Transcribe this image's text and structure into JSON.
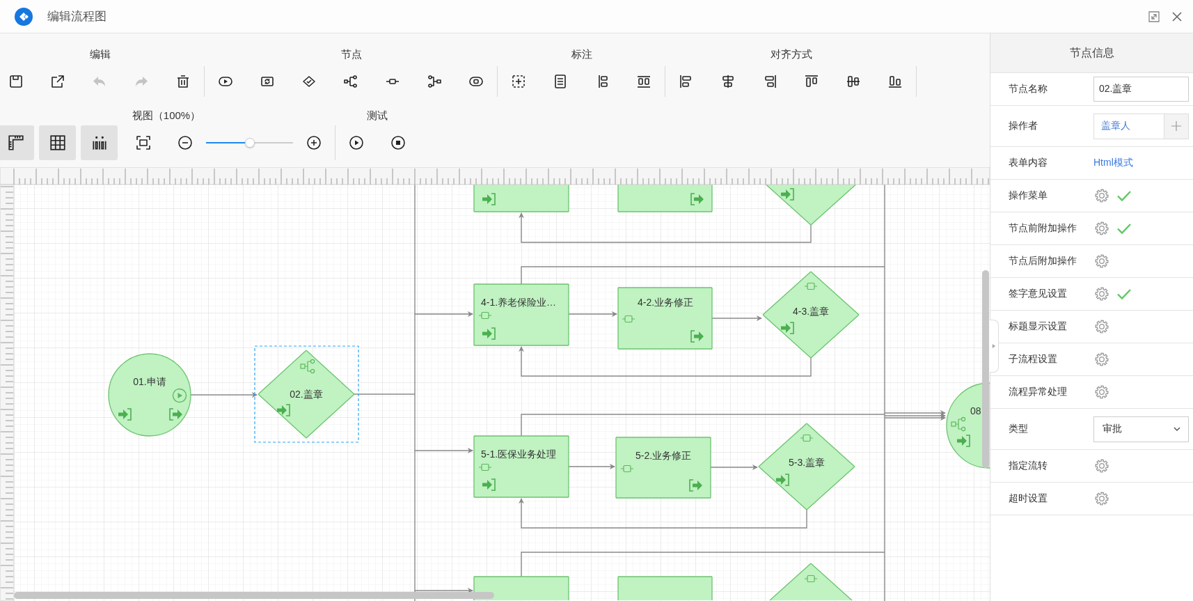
{
  "window": {
    "title": "编辑流程图"
  },
  "toolbar": {
    "rows": [
      {
        "groups": [
          {
            "label": "编辑",
            "tools": [
              {
                "kind": "button",
                "disabled": false
              },
              {
                "kind": "button",
                "disabled": false
              },
              {
                "kind": "button",
                "disabled": true
              },
              {
                "kind": "button",
                "disabled": true
              },
              {
                "kind": "button",
                "disabled": false
              }
            ]
          },
          {
            "label": "节点",
            "tools": [
              {
                "kind": "button",
                "disabled": false
              },
              {
                "kind": "button",
                "disabled": false
              },
              {
                "kind": "button",
                "disabled": false
              },
              {
                "kind": "button",
                "disabled": false
              },
              {
                "kind": "button",
                "disabled": false
              },
              {
                "kind": "button",
                "disabled": false
              },
              {
                "kind": "button",
                "disabled": false
              }
            ]
          },
          {
            "label": "标注",
            "tools": [
              {
                "kind": "button",
                "disabled": false
              },
              {
                "kind": "button",
                "disabled": false
              },
              {
                "kind": "button",
                "disabled": false
              },
              {
                "kind": "button",
                "disabled": false
              }
            ]
          },
          {
            "label": "对齐方式",
            "tools": [
              {
                "kind": "button",
                "disabled": false
              },
              {
                "kind": "button",
                "disabled": false
              },
              {
                "kind": "button",
                "disabled": false
              },
              {
                "kind": "button",
                "disabled": false
              },
              {
                "kind": "button",
                "disabled": false
              },
              {
                "kind": "button",
                "disabled": false
              }
            ]
          }
        ]
      },
      {
        "groups": [
          {
            "label": "视图（100%）",
            "tools": [
              {
                "kind": "toggle",
                "on": true
              },
              {
                "kind": "toggle",
                "on": true
              },
              {
                "kind": "toggle",
                "on": true
              },
              {
                "kind": "button",
                "disabled": false
              },
              {
                "kind": "button",
                "disabled": false
              },
              {
                "kind": "slider",
                "level": 0.5
              },
              {
                "kind": "button",
                "disabled": false
              }
            ]
          },
          {
            "label": "测试",
            "tools": [
              {
                "kind": "button",
                "disabled": false
              },
              {
                "kind": "button",
                "disabled": false
              }
            ]
          }
        ]
      }
    ]
  },
  "canvas": {
    "nodes": [
      {
        "kind": "circle",
        "label": "01.申请",
        "selected": false
      },
      {
        "kind": "diamond",
        "label": "02.盖章",
        "selected": true
      },
      {
        "kind": "rect",
        "selected": false
      },
      {
        "kind": "rect",
        "selected": false
      },
      {
        "kind": "diamond",
        "selected": false
      },
      {
        "kind": "rect",
        "label": "4-1.养老保险业…",
        "selected": false
      },
      {
        "kind": "rect",
        "label": "4-2.业务修正",
        "selected": false
      },
      {
        "kind": "diamond",
        "label": "4-3.盖章",
        "selected": false
      },
      {
        "kind": "rect",
        "label": "5-1.医保业务处理",
        "selected": false
      },
      {
        "kind": "rect",
        "label": "5-2.业务修正",
        "selected": false
      },
      {
        "kind": "diamond",
        "label": "5-3.盖章",
        "selected": false
      },
      {
        "kind": "rect",
        "selected": false
      },
      {
        "kind": "rect",
        "selected": false
      },
      {
        "kind": "diamond",
        "selected": false
      },
      {
        "kind": "circle",
        "label": "08",
        "selected": false
      }
    ]
  },
  "panel": {
    "title": "节点信息",
    "rows": [
      {
        "label": "节点名称",
        "kind": "input",
        "value": "02.盖章"
      },
      {
        "label": "操作者",
        "kind": "picker",
        "value": "盖章人"
      },
      {
        "label": "表单内容",
        "kind": "link",
        "value": "Html模式"
      },
      {
        "label": "操作菜单",
        "kind": "gear",
        "checked": true
      },
      {
        "label": "节点前附加操作",
        "kind": "gear",
        "checked": true
      },
      {
        "label": "节点后附加操作",
        "kind": "gear",
        "checked": false
      },
      {
        "label": "签字意见设置",
        "kind": "gear",
        "checked": true
      },
      {
        "label": "标题显示设置",
        "kind": "gear",
        "checked": false
      },
      {
        "label": "子流程设置",
        "kind": "gear",
        "checked": false
      },
      {
        "label": "流程异常处理",
        "kind": "gear",
        "checked": false
      },
      {
        "label": "类型",
        "kind": "select",
        "value": "审批"
      },
      {
        "label": "指定流转",
        "kind": "gear",
        "checked": false
      },
      {
        "label": "超时设置",
        "kind": "gear",
        "checked": false
      }
    ]
  }
}
